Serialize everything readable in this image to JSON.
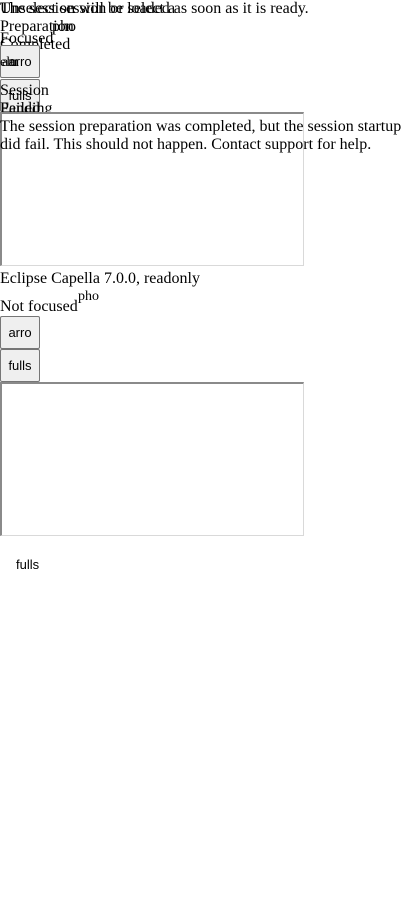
{
  "session1": {
    "message_back": "The session will be loaded as soon as it is ready.",
    "message_front": "Unselect session or select a",
    "preparation_label": "Preparation",
    "icon_overlay": "pho",
    "focused": "Focused",
    "completed": "Completed",
    "arrow_btn": "arro",
    "fullscreen_overlay": "fulls",
    "fragment_a": "elu",
    "fragment_b": "am",
    "session_label": "Session",
    "failed": "Failed",
    "pending": "Pending",
    "error_text": "The session preparation was completed, but the session startup did fail. This should not happen. Contact support for help."
  },
  "session2": {
    "title": "Eclipse Capella 7.0.0, readonly",
    "focus_status": "Not focused",
    "icon": "pho",
    "arrow_btn": "arro",
    "fullscreen_btn": "fulls"
  },
  "bottom": {
    "fullscreen_label": "fulls"
  }
}
